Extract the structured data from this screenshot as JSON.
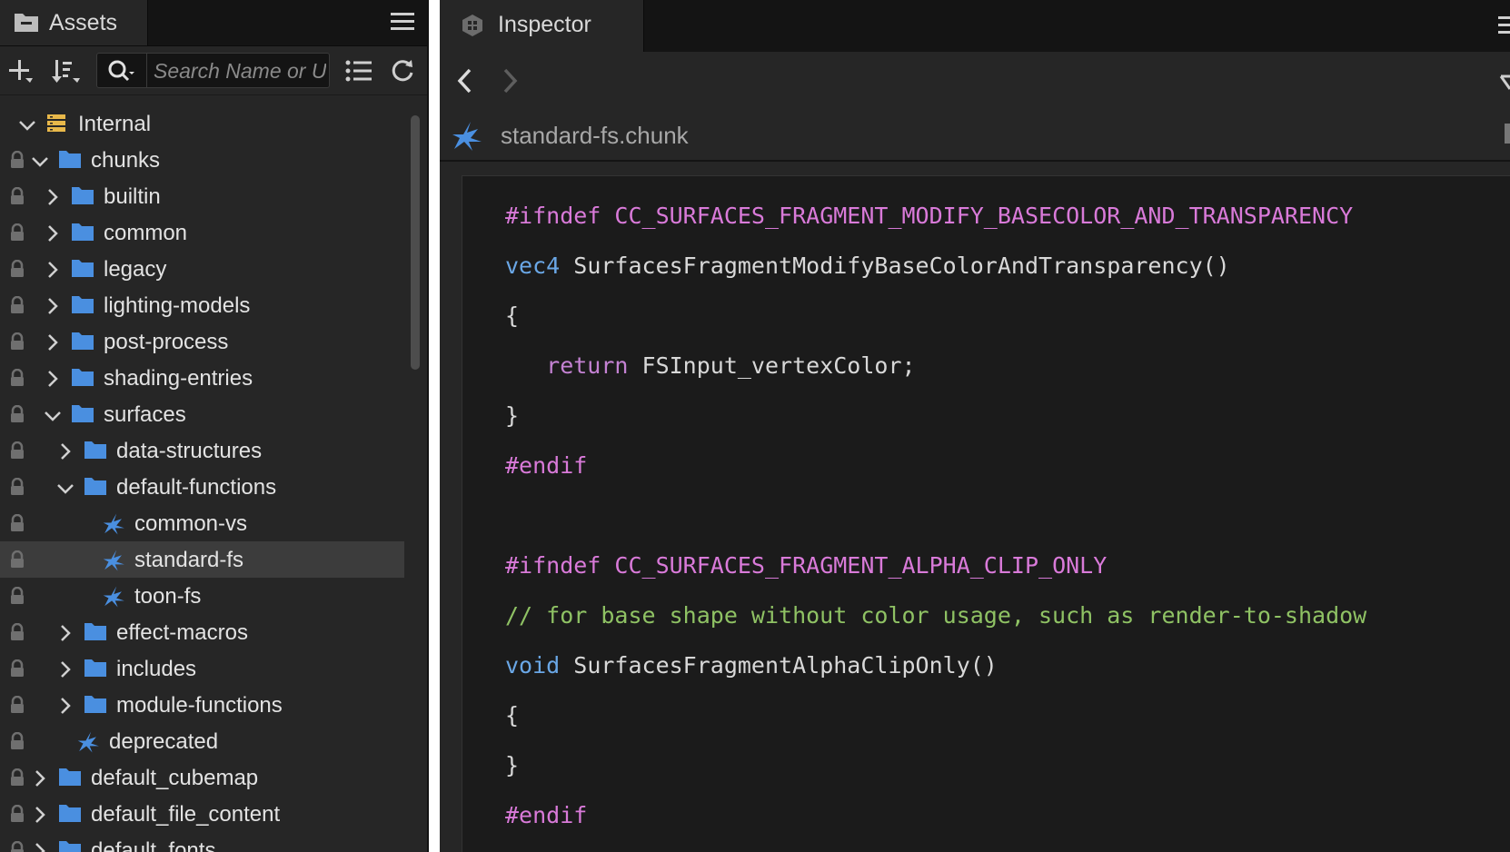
{
  "assets_panel": {
    "tab_title": "Assets",
    "search_placeholder": "Search Name or UUID",
    "tree": [
      {
        "label": "Internal",
        "depth": 0,
        "expanded": true,
        "has_children": true,
        "icon": "database-icon",
        "locked": false,
        "selected": false
      },
      {
        "label": "chunks",
        "depth": 1,
        "expanded": true,
        "has_children": true,
        "icon": "folder-icon",
        "locked": true,
        "selected": false
      },
      {
        "label": "builtin",
        "depth": 2,
        "expanded": false,
        "has_children": true,
        "icon": "folder-icon",
        "locked": true,
        "selected": false
      },
      {
        "label": "common",
        "depth": 2,
        "expanded": false,
        "has_children": true,
        "icon": "folder-icon",
        "locked": true,
        "selected": false
      },
      {
        "label": "legacy",
        "depth": 2,
        "expanded": false,
        "has_children": true,
        "icon": "folder-icon",
        "locked": true,
        "selected": false
      },
      {
        "label": "lighting-models",
        "depth": 2,
        "expanded": false,
        "has_children": true,
        "icon": "folder-icon",
        "locked": true,
        "selected": false
      },
      {
        "label": "post-process",
        "depth": 2,
        "expanded": false,
        "has_children": true,
        "icon": "folder-icon",
        "locked": true,
        "selected": false
      },
      {
        "label": "shading-entries",
        "depth": 2,
        "expanded": false,
        "has_children": true,
        "icon": "folder-icon",
        "locked": true,
        "selected": false
      },
      {
        "label": "surfaces",
        "depth": 2,
        "expanded": true,
        "has_children": true,
        "icon": "folder-icon",
        "locked": true,
        "selected": false
      },
      {
        "label": "data-structures",
        "depth": 3,
        "expanded": false,
        "has_children": true,
        "icon": "folder-icon",
        "locked": true,
        "selected": false
      },
      {
        "label": "default-functions",
        "depth": 3,
        "expanded": true,
        "has_children": true,
        "icon": "folder-icon",
        "locked": true,
        "selected": false
      },
      {
        "label": "common-vs",
        "depth": 4,
        "expanded": false,
        "has_children": false,
        "icon": "chunk-icon",
        "locked": true,
        "selected": false
      },
      {
        "label": "standard-fs",
        "depth": 4,
        "expanded": false,
        "has_children": false,
        "icon": "chunk-icon",
        "locked": true,
        "selected": true
      },
      {
        "label": "toon-fs",
        "depth": 4,
        "expanded": false,
        "has_children": false,
        "icon": "chunk-icon",
        "locked": true,
        "selected": false
      },
      {
        "label": "effect-macros",
        "depth": 3,
        "expanded": false,
        "has_children": true,
        "icon": "folder-icon",
        "locked": true,
        "selected": false
      },
      {
        "label": "includes",
        "depth": 3,
        "expanded": false,
        "has_children": true,
        "icon": "folder-icon",
        "locked": true,
        "selected": false
      },
      {
        "label": "module-functions",
        "depth": 3,
        "expanded": false,
        "has_children": true,
        "icon": "folder-icon",
        "locked": true,
        "selected": false
      },
      {
        "label": "deprecated",
        "depth": 2,
        "expanded": false,
        "has_children": false,
        "icon": "chunk-icon",
        "locked": true,
        "selected": false
      },
      {
        "label": "default_cubemap",
        "depth": 1,
        "expanded": false,
        "has_children": true,
        "icon": "folder-icon",
        "locked": true,
        "selected": false
      },
      {
        "label": "default_file_content",
        "depth": 1,
        "expanded": false,
        "has_children": true,
        "icon": "folder-icon",
        "locked": true,
        "selected": false
      },
      {
        "label": "default_fonts",
        "depth": 1,
        "expanded": false,
        "has_children": true,
        "icon": "folder-icon",
        "locked": true,
        "selected": false
      }
    ]
  },
  "inspector_panel": {
    "tab_title": "Inspector",
    "file_name": "standard-fs.chunk",
    "code_lines": [
      [
        {
          "t": "#ifndef ",
          "c": "kw-pre"
        },
        {
          "t": "CC_SURFACES_FRAGMENT_MODIFY_BASECOLOR_AND_TRANSPARENCY",
          "c": "kw-pre"
        }
      ],
      [
        {
          "t": "vec4",
          "c": "kw-type"
        },
        {
          "t": " SurfacesFragmentModifyBaseColorAndTransparency()",
          "c": "ident"
        }
      ],
      [
        {
          "t": "{",
          "c": "punct"
        }
      ],
      [
        {
          "t": "   ",
          "c": "ident"
        },
        {
          "t": "return",
          "c": "kw-ret"
        },
        {
          "t": " FSInput_vertexColor;",
          "c": "ident"
        }
      ],
      [
        {
          "t": "}",
          "c": "punct"
        }
      ],
      [
        {
          "t": "#endif",
          "c": "kw-pre"
        }
      ],
      [],
      [
        {
          "t": "#ifndef ",
          "c": "kw-pre"
        },
        {
          "t": "CC_SURFACES_FRAGMENT_ALPHA_CLIP_ONLY",
          "c": "kw-pre"
        }
      ],
      [
        {
          "t": "// for base shape without color usage, such as render-to-shadow",
          "c": "comment"
        }
      ],
      [
        {
          "t": "void",
          "c": "kw-type"
        },
        {
          "t": " SurfacesFragmentAlphaClipOnly()",
          "c": "ident"
        }
      ],
      [
        {
          "t": "{",
          "c": "punct"
        }
      ],
      [
        {
          "t": "}",
          "c": "punct"
        }
      ],
      [
        {
          "t": "#endif",
          "c": "kw-pre"
        }
      ]
    ]
  },
  "colors": {
    "panel_bg": "#262626",
    "code_bg": "#1b1b1b",
    "folder_blue": "#4a8fe0",
    "selected_row": "#3c3c3c",
    "preprocessor": "#d97ad9",
    "type_keyword": "#6aa7e6",
    "comment": "#8fc264"
  }
}
